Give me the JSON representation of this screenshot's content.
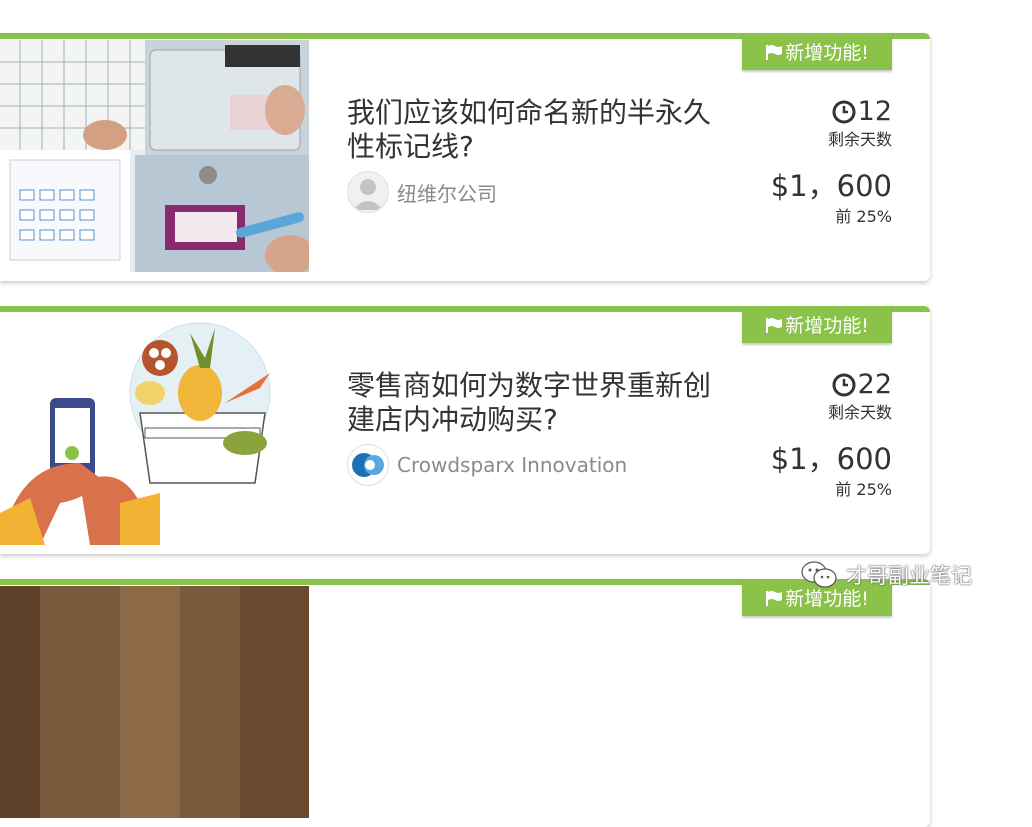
{
  "badge_label": "新增功能!",
  "days_label": "剩余天数",
  "cards": [
    {
      "title": "我们应该如何命名新的半永久性标记线?",
      "company": "纽维尔公司",
      "company_logo": "default-avatar-icon",
      "days_left": "12",
      "prize": "$1，600",
      "rank": "前 25%",
      "thumbnail": "markers-whiteboard-photo"
    },
    {
      "title": "零售商如何为数字世界重新创建店内冲动购买?",
      "company": "Crowdsparx Innovation",
      "company_logo": "crowdsparx-logo",
      "days_left": "22",
      "prize": "$1，600",
      "rank": "前 25%",
      "thumbnail": "grocery-phone-illustration"
    },
    {
      "thumbnail": "wood-photo"
    }
  ],
  "watermark": "才哥副业笔记",
  "colors": {
    "accent": "#8bc34a",
    "text": "#333333",
    "muted": "#8a8a8a"
  }
}
